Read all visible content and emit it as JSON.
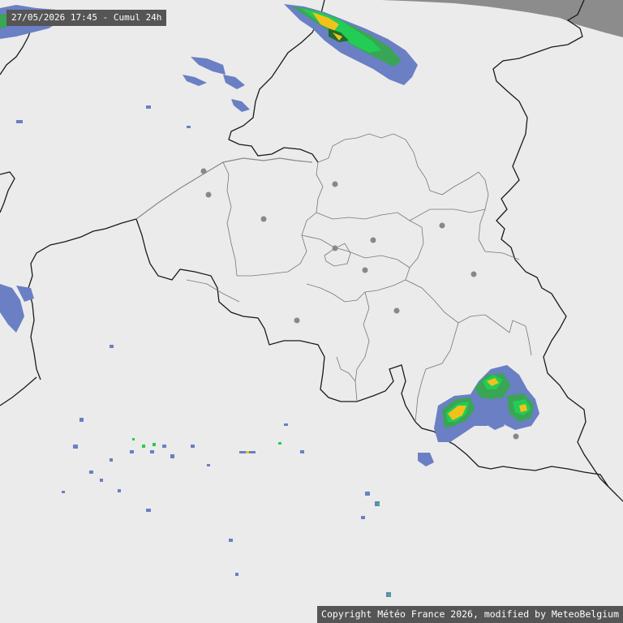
{
  "header": {
    "timestamp": "27/05/2026 17:45 - Cumul 24h"
  },
  "footer": {
    "copyright": "Copyright Météo France 2026, modified by MeteoBelgium"
  },
  "colors": {
    "background": "#ebebeb",
    "sea": "#8c8c8c",
    "border": "#1a1a1a",
    "province_border": "#777777",
    "city_dot": "#888888",
    "rain_light": "#6a7fc4",
    "rain_medium": "#3aa555",
    "rain_strong": "#22cc55",
    "rain_heavy": "#f2c21a",
    "rain_darkgreen": "#1f6b2a"
  },
  "map": {
    "region": "Belgium radar precipitation accumulation",
    "legend_present": false
  }
}
